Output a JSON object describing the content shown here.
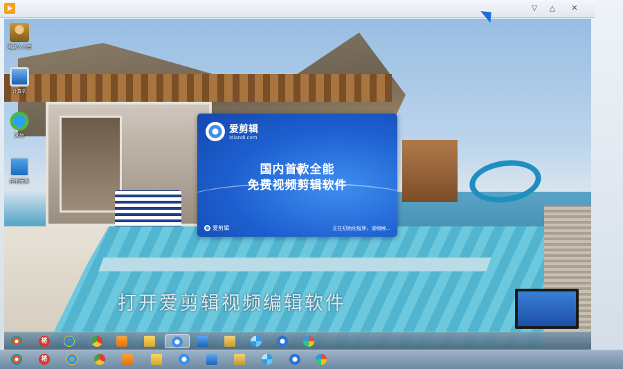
{
  "window": {
    "controls": {
      "minimize": "▽",
      "maximize": "△",
      "close": "✕"
    }
  },
  "desktop_icons": [
    {
      "label": "电脑人人有",
      "icon": "user-folder-icon"
    },
    {
      "label": "计算机",
      "icon": "computer-icon"
    },
    {
      "label": "网络",
      "icon": "network-icon"
    },
    {
      "label": "控制面板",
      "icon": "control-panel-icon"
    }
  ],
  "splash": {
    "app_name": "爱剪辑",
    "url": "idiandi.com",
    "slogan_line1": "国内首款全能",
    "slogan_line2": "免费视频剪辑软件",
    "footer_name": "爱剪辑",
    "status": "正在初始化程序，请稍候..."
  },
  "caption": "打开爱剪辑视频编辑软件",
  "taskbar_inner": [
    {
      "icon": "windows-start-icon"
    },
    {
      "icon": "jiang-app-icon",
      "text": "将"
    },
    {
      "icon": "ie-browser-icon"
    },
    {
      "icon": "chrome-icon"
    },
    {
      "icon": "media-player-icon"
    },
    {
      "icon": "folder-icon"
    },
    {
      "icon": "aijianji-icon",
      "active": true
    },
    {
      "icon": "remote-desktop-icon"
    },
    {
      "icon": "file-folder-icon"
    },
    {
      "icon": "pinwheel-icon"
    },
    {
      "icon": "blue-app-icon"
    },
    {
      "icon": "paint-icon"
    }
  ],
  "colors": {
    "splash_blue": "#1d5fd0",
    "accent_orange": "#f2a51c"
  }
}
